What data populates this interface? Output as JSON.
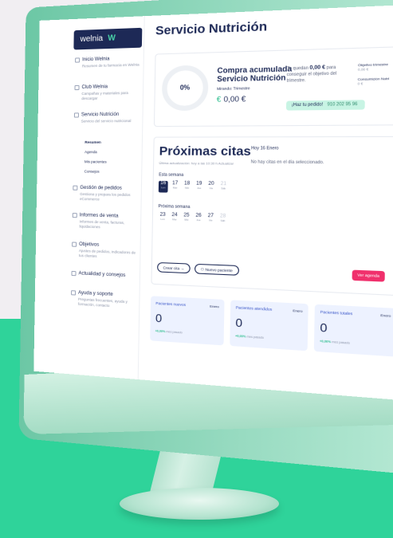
{
  "sidebar": {
    "logo": "welnia",
    "items": [
      {
        "title": "Inicio Welnia",
        "sub": "Resumen de tu farmacia en Welnia"
      },
      {
        "title": "Club Welnia",
        "sub": "Campañas y materiales para descargar"
      },
      {
        "title": "Servicio Nutrición",
        "sub": "Servicio del servicio nutricional"
      },
      {
        "title": "Gestión de pedidos",
        "sub": "Gestiona y prepara los pedidos eCommerce"
      },
      {
        "title": "Informes de venta",
        "sub": "Informes de venta, facturas, liquidaciones"
      },
      {
        "title": "Objetivos",
        "sub": "Ajustes de pedidos, indicadores de tus clientes"
      },
      {
        "title": "Actualidad y consejos",
        "sub": ""
      },
      {
        "title": "Ayuda y soporte",
        "sub": "Preguntas frecuentes, ayuda y formación, contacto"
      }
    ],
    "sublinks": [
      "Resumen",
      "Agenda",
      "Mis pacientes",
      "Consejos"
    ]
  },
  "main": {
    "title": "Servicio Nutrición",
    "summary": {
      "percent": "0%",
      "compra_line1": "Compra acumulada",
      "compra_line2": "Servicio Nutrición",
      "viewing": "Mirando: Trimestre",
      "currency": "€",
      "amount": "0,00 €",
      "faltan_pre": "Te quedan",
      "faltan_amount": "0,00 €",
      "faltan_post": "para conseguir el objetivo del trimestre.",
      "obj1_label": "Objetivo trimestre",
      "obj1_value": "0,00 €",
      "obj2_label": "Consumición Nutri",
      "obj2_value": "0 €",
      "pedido_label": "¡Haz tu pedido!",
      "pedido_phone": "910 202 95 96"
    },
    "citas": {
      "title": "Próximas citas",
      "sub": "Última actualización: hoy a las 10:30 h Actualizar",
      "date": "Hoy 16 Enero",
      "no_citas": "No hay citas en el día seleccionado.",
      "week1_label": "Esta semana",
      "week2_label": "Próxima semana",
      "week1": [
        {
          "d": "16",
          "w": "Lun"
        },
        {
          "d": "17",
          "w": "Mar"
        },
        {
          "d": "18",
          "w": "Mié"
        },
        {
          "d": "19",
          "w": "Jue"
        },
        {
          "d": "20",
          "w": "Vie"
        },
        {
          "d": "21",
          "w": "Sáb"
        }
      ],
      "week2": [
        {
          "d": "23",
          "w": "Lun"
        },
        {
          "d": "24",
          "w": "Mar"
        },
        {
          "d": "25",
          "w": "Mié"
        },
        {
          "d": "26",
          "w": "Jue"
        },
        {
          "d": "27",
          "w": "Vie"
        },
        {
          "d": "28",
          "w": "Sáb"
        }
      ],
      "btn_cita": "Crear cita",
      "btn_paciente": "Nuevo paciente",
      "btn_agenda": "Ver agenda"
    },
    "stats": [
      {
        "label": "Pacientes nuevos",
        "period": "Enero",
        "value": "0",
        "change": "+0,00%",
        "change_post": "mes pasado"
      },
      {
        "label": "Pacientes atendidos",
        "period": "Enero",
        "value": "0",
        "change": "+0,00%",
        "change_post": "mes pasado"
      },
      {
        "label": "Pacientes totales",
        "period": "Enero",
        "value": "0",
        "change": "+0,00%",
        "change_post": "mes pasado"
      }
    ]
  }
}
